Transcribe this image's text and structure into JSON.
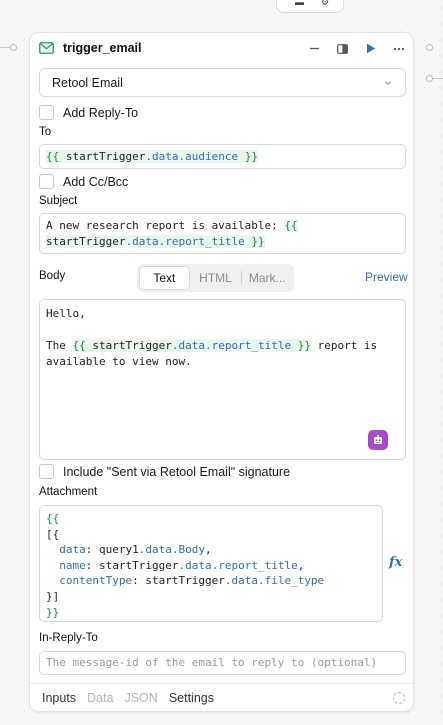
{
  "node": {
    "title": "trigger_email",
    "icon": "mail-icon",
    "resource": "Retool Email"
  },
  "options": {
    "add_reply_to": "Add Reply-To",
    "add_cc_bcc": "Add Cc/Bcc",
    "signature": "Include \"Sent via Retool Email\" signature"
  },
  "to": {
    "label": "To",
    "open": "{{",
    "obj": "startTrigger",
    "path": ".data.audience",
    "close": "}}"
  },
  "subject": {
    "label": "Subject",
    "text": "A new research report is available: ",
    "open": "{{",
    "obj": "startTrigger",
    "path": ".data.report_title",
    "close": "}}"
  },
  "body": {
    "label": "Body",
    "tabs": [
      "Text",
      "HTML",
      "Mark..."
    ],
    "active_tab": "Text",
    "preview": "Preview",
    "line1": "Hello,",
    "pre": "The ",
    "open": "{{",
    "obj": "startTrigger",
    "path": ".data.report_title",
    "close": "}}",
    "post1": " report is",
    "post2": "available to view now."
  },
  "attachment": {
    "label": "Attachment",
    "fx": "fx",
    "lines": {
      "open": "{{",
      "lb": "[{",
      "k1": "data",
      "v1_obj": "query1",
      "v1_path": ".data.Body",
      "k2": "name",
      "v2_obj": "startTrigger",
      "v2_path": ".data.report_title",
      "k3": "contentType",
      "v3_obj": "startTrigger",
      "v3_path": ".data.file_type",
      "rb": "}]",
      "close": "}}"
    }
  },
  "in_reply_to": {
    "label": "In-Reply-To",
    "placeholder": "The message-id of the email to reply to (optional)"
  },
  "footer": {
    "tabs": [
      "Inputs",
      "Data",
      "JSON",
      "Settings"
    ],
    "active": [
      "Inputs",
      "Settings"
    ]
  },
  "colors": {
    "accent": "#2f6fb5",
    "binding": "#1d8a44",
    "ai": "#a64bc9"
  }
}
